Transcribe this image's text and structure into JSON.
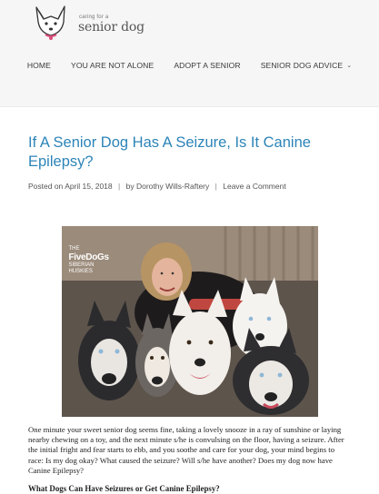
{
  "site": {
    "logo_small": "caring for a",
    "logo_big": "senior dog"
  },
  "nav": {
    "items": [
      {
        "label": "HOME"
      },
      {
        "label": "YOU ARE NOT ALONE"
      },
      {
        "label": "ADOPT A SENIOR"
      },
      {
        "label": "SENIOR DOG ADVICE",
        "has_dropdown": true
      }
    ]
  },
  "post": {
    "title": "If A Senior Dog Has A Seizure, Is It Canine Epilepsy?",
    "meta_prefix": "Posted on",
    "date": "April 15, 2018",
    "author_prefix": "by",
    "author": "Dorothy Wills-Raftery",
    "comment_link": "Leave a Comment",
    "image_badge_top": "THE",
    "image_badge_main": "FiveDoGs",
    "image_badge_sub": "SIBERIAN HUSKIES",
    "paragraph": "One minute your sweet senior dog seems fine, taking a lovely snooze in a ray of sunshine or laying nearby chewing on a toy, and the next minute s/he is convulsing on the floor, having a seizure. After the initial fright and fear starts to ebb, and you soothe and care for your dog, your mind begins to race: Is my dog okay? What caused the seizure? Will s/he have another? Does my dog now have Canine Epilepsy?",
    "subheading": "What Dogs Can Have Seizures or Get Canine Epilepsy?"
  },
  "colors": {
    "accent": "#2c84b8",
    "header_bg": "#f6f6f6",
    "logo_pink": "#d94f7a"
  }
}
